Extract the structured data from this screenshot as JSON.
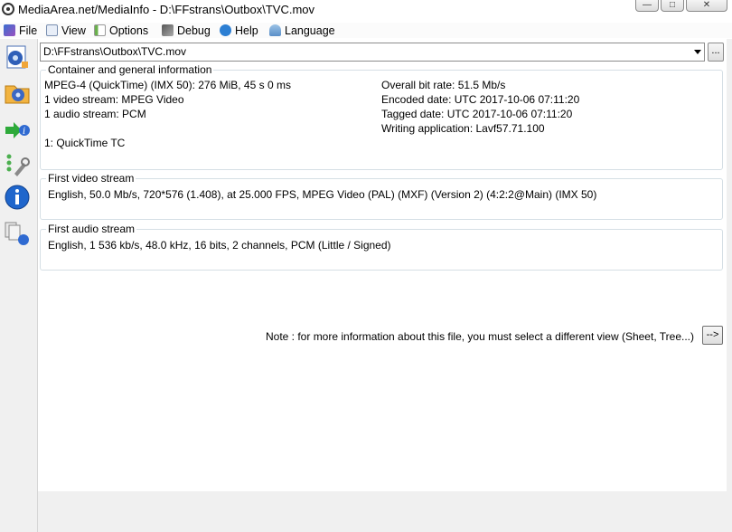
{
  "window": {
    "title": "MediaArea.net/MediaInfo - D:\\FFstrans\\Outbox\\TVC.mov",
    "controls": {
      "minimize": "—",
      "maximize": "□",
      "close": "✕"
    }
  },
  "menu": {
    "items": [
      {
        "label": "File",
        "icon": "file-icon"
      },
      {
        "label": "View",
        "icon": "view-icon"
      },
      {
        "label": "Options",
        "icon": "options-icon"
      },
      {
        "label": "Debug",
        "icon": "debug-icon"
      },
      {
        "label": "Help",
        "icon": "help-icon"
      },
      {
        "label": "Language",
        "icon": "language-icon"
      }
    ]
  },
  "sidebar": {
    "buttons": [
      {
        "name": "open-file-icon"
      },
      {
        "name": "open-folder-icon"
      },
      {
        "name": "export-icon"
      },
      {
        "name": "preferences-icon"
      },
      {
        "name": "about-icon"
      },
      {
        "name": "knowledge-base-icon"
      }
    ]
  },
  "file_path": {
    "value": "D:\\FFstrans\\Outbox\\TVC.mov",
    "browse_label": "..."
  },
  "general": {
    "title": "Container and general information",
    "left_lines": [
      "MPEG-4 (QuickTime) (IMX 50): 276 MiB, 45 s 0 ms",
      "1 video stream: MPEG Video",
      "1 audio stream: PCM",
      "1: QuickTime TC"
    ],
    "right_lines": [
      "Overall bit rate: 51.5 Mb/s",
      "Encoded date: UTC 2017-10-06 07:11:20",
      "Tagged date: UTC 2017-10-06 07:11:20",
      "Writing application: Lavf57.71.100"
    ]
  },
  "video": {
    "title": "First video stream",
    "line": "English, 50.0 Mb/s, 720*576 (1.408), at 25.000 FPS, MPEG Video (PAL) (MXF) (Version 2) (4:2:2@Main) (IMX 50)"
  },
  "audio": {
    "title": "First audio stream",
    "line": "English, 1 536 kb/s, 48.0 kHz, 16 bits, 2 channels, PCM (Little / Signed)"
  },
  "note": {
    "text": "Note : for more information about this file, you must select a different view (Sheet, Tree...)",
    "button_label": "-->"
  }
}
